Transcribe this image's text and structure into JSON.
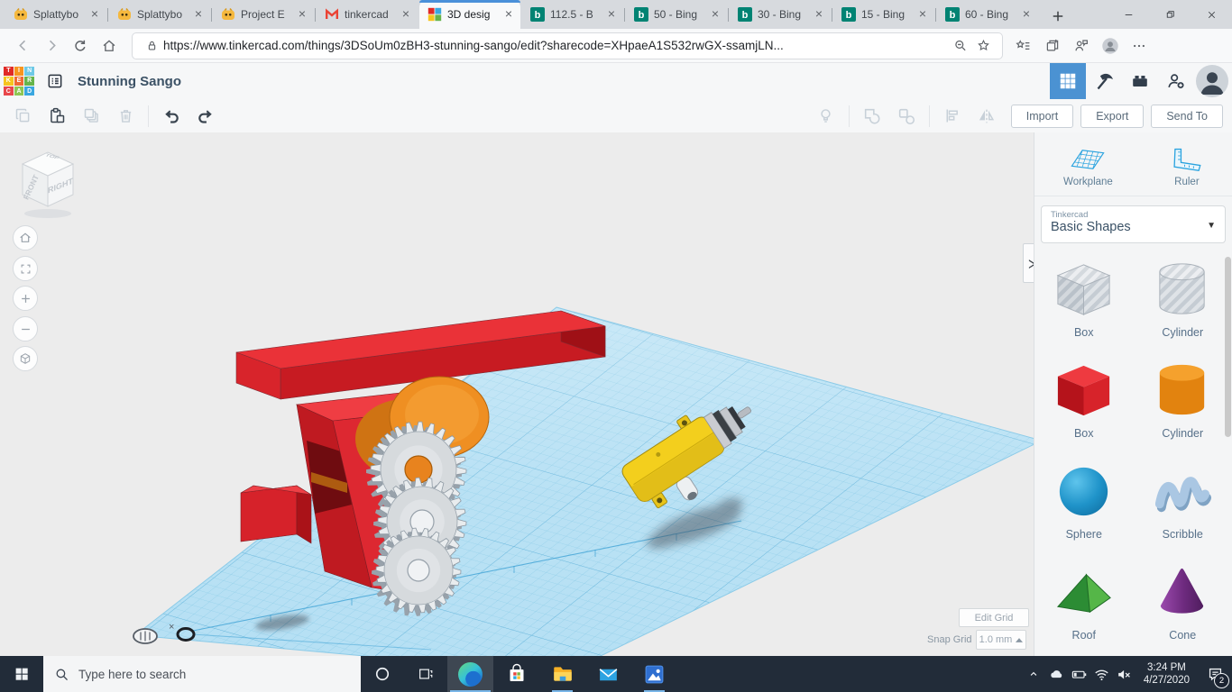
{
  "browser": {
    "tab_strip": {
      "tabs": [
        {
          "label": "Splattybo",
          "icon": "creature",
          "active": false
        },
        {
          "label": "Splattybo",
          "icon": "creature",
          "active": false
        },
        {
          "label": "Project E",
          "icon": "creature",
          "active": false
        },
        {
          "label": "tinkercad",
          "icon": "gmail",
          "active": false
        },
        {
          "label": "3D desig",
          "icon": "tinkercad",
          "active": true
        },
        {
          "label": "112.5 - B",
          "icon": "bing",
          "active": false
        },
        {
          "label": "50 - Bing",
          "icon": "bing",
          "active": false
        },
        {
          "label": "30 - Bing",
          "icon": "bing",
          "active": false
        },
        {
          "label": "15 - Bing",
          "icon": "bing",
          "active": false
        },
        {
          "label": "60 - Bing",
          "icon": "bing",
          "active": false
        }
      ],
      "window_controls": [
        "minimize",
        "maximize",
        "close"
      ]
    },
    "navbar": {
      "nav_icons": [
        "back",
        "forward",
        "refresh",
        "home"
      ],
      "url": "https://www.tinkercad.com/things/3DSoUm0zBH3-stunning-sango/edit?sharecode=XHpaeA1S532rwGX-ssamjLN...",
      "url_trailing_icons": [
        "zoom-out",
        "favorite-star"
      ],
      "right_icons": [
        "favorites-bar",
        "collections",
        "feedback",
        "profile",
        "more"
      ]
    }
  },
  "tinkercad": {
    "header": {
      "title": "Stunning Sango",
      "logo_letters": "TINKERCAD",
      "logo_colors": [
        "#e02a26",
        "#f7941e",
        "#6ec9e6",
        "#f6c51e",
        "#ef6a32",
        "#66b44b",
        "#e8474b",
        "#8fc653",
        "#3aa7e0"
      ],
      "right_icons": [
        "blocks-grid",
        "minecraft-pickaxe",
        "lego-brick",
        "invite-person",
        "account-avatar"
      ]
    },
    "toolbar": {
      "left_icons": [
        {
          "name": "copy",
          "enabled": false
        },
        {
          "name": "paste",
          "enabled": true
        },
        {
          "name": "duplicate",
          "enabled": false
        },
        {
          "name": "delete",
          "enabled": false
        }
      ],
      "history_icons": [
        {
          "name": "undo",
          "enabled": true
        },
        {
          "name": "redo",
          "enabled": true
        }
      ],
      "right_icons": [
        {
          "name": "show-all",
          "enabled": false
        },
        {
          "name": "group",
          "enabled": false
        },
        {
          "name": "ungroup",
          "enabled": false
        },
        {
          "name": "align",
          "enabled": false
        },
        {
          "name": "mirror",
          "enabled": false
        }
      ],
      "buttons": [
        "Import",
        "Export",
        "Send To"
      ]
    },
    "viewport": {
      "view_cube": {
        "top": "TOP",
        "front": "FRONT",
        "right": "RIGHT"
      },
      "nav_icons": [
        "home-view",
        "fit-view",
        "zoom-in",
        "zoom-out",
        "perspective"
      ],
      "edit_grid_button": "Edit Grid",
      "snap_grid_label": "Snap Grid",
      "snap_grid_value": "1.0 mm",
      "scene_objects": [
        {
          "name": "red-bar",
          "color": "#d6222a"
        },
        {
          "name": "gear-housing",
          "color": "#c01c22"
        },
        {
          "name": "orange-drum",
          "color": "#ef8f22"
        },
        {
          "name": "gear-train",
          "color": "#dfe3e6"
        },
        {
          "name": "small-red-cube",
          "color": "#d6222a"
        },
        {
          "name": "yellow-gear-motor",
          "color": "#f3cf1d"
        }
      ]
    },
    "sidebar": {
      "workplane_label": "Workplane",
      "ruler_label": "Ruler",
      "library_brand": "Tinkercad",
      "library_category": "Basic Shapes",
      "shapes": [
        {
          "name": "Box",
          "kind": "box-striped"
        },
        {
          "name": "Cylinder",
          "kind": "cylinder-striped"
        },
        {
          "name": "Box",
          "kind": "box-red"
        },
        {
          "name": "Cylinder",
          "kind": "cylinder-orange"
        },
        {
          "name": "Sphere",
          "kind": "sphere"
        },
        {
          "name": "Scribble",
          "kind": "scribble"
        },
        {
          "name": "Roof",
          "kind": "roof"
        },
        {
          "name": "Cone",
          "kind": "cone"
        }
      ]
    }
  },
  "taskbar": {
    "search_placeholder": "Type here to search",
    "apps": [
      {
        "name": "edge",
        "state": "active"
      },
      {
        "name": "store",
        "state": ""
      },
      {
        "name": "file-explorer",
        "state": "running"
      },
      {
        "name": "mail",
        "state": ""
      },
      {
        "name": "photos",
        "state": "running"
      }
    ],
    "tray_icons": [
      "chevron-up",
      "onedrive",
      "battery",
      "wifi",
      "volume-muted"
    ],
    "time": "3:24 PM",
    "date": "4/27/2020",
    "notification_badge": "2"
  },
  "colors": {
    "accent_blue": "#4a90d9",
    "tinkercad_blue": "#4b92d2",
    "grid_blue": "#b6e0f4",
    "red": "#d6222a",
    "orange": "#ef8f22",
    "yellow": "#f3cf1d",
    "bing_teal": "#008373",
    "taskbar_bg": "#222c39"
  }
}
